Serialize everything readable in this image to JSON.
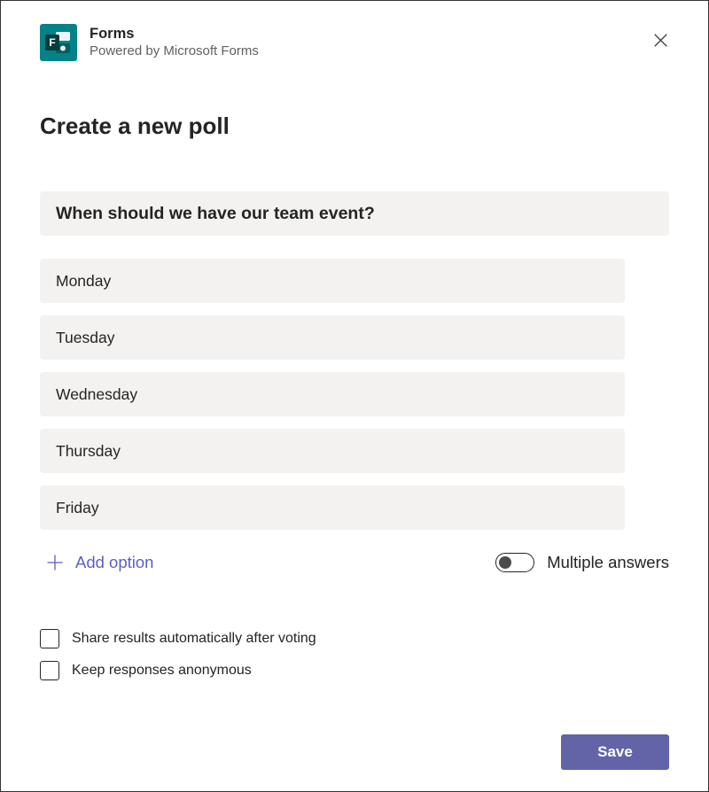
{
  "header": {
    "app_title": "Forms",
    "app_subtitle": "Powered by Microsoft Forms",
    "icon_name": "forms-icon"
  },
  "page_title": "Create a new poll",
  "poll": {
    "question": "When should we have our team event?",
    "options": [
      "Monday",
      "Tuesday",
      "Wednesday",
      "Thursday",
      "Friday"
    ],
    "add_option_label": "Add option",
    "multiple_answers": {
      "label": "Multiple answers",
      "on": false
    }
  },
  "settings": {
    "share_results": {
      "label": "Share results automatically after voting",
      "checked": false
    },
    "anonymous": {
      "label": "Keep responses anonymous",
      "checked": false
    }
  },
  "actions": {
    "save_label": "Save"
  },
  "colors": {
    "accent": "#6264a7",
    "forms_brand": "#038387",
    "field_bg": "#f3f2f1"
  }
}
